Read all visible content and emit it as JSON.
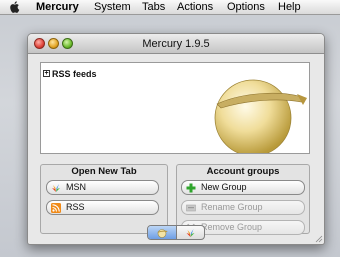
{
  "menubar": {
    "app": "Mercury",
    "items": [
      "System",
      "Tabs",
      "Actions",
      "Options",
      "Help"
    ]
  },
  "window": {
    "title": "Mercury 1.9.5"
  },
  "feeds": {
    "toggle": "+",
    "label": "RSS feeds"
  },
  "open_tab": {
    "title": "Open New Tab",
    "buttons": [
      {
        "label": "MSN",
        "icon": "msn-butterfly-icon",
        "enabled": true
      },
      {
        "label": "RSS",
        "icon": "rss-icon",
        "enabled": true
      }
    ]
  },
  "account_groups": {
    "title": "Account groups",
    "buttons": [
      {
        "label": "New Group",
        "icon": "plus-icon",
        "enabled": true
      },
      {
        "label": "Rename Group",
        "icon": "rename-icon",
        "enabled": false
      },
      {
        "label": "Remove Group",
        "icon": "remove-x-icon",
        "enabled": false
      }
    ]
  },
  "bottom_tabs": [
    {
      "icon": "mercury-moon-icon",
      "selected": true
    },
    {
      "icon": "msn-butterfly-icon",
      "selected": false
    }
  ],
  "colors": {
    "selected_tab": "#6e9ee4",
    "plus_green": "#2fa52c",
    "rss_orange": "#f08a18"
  }
}
